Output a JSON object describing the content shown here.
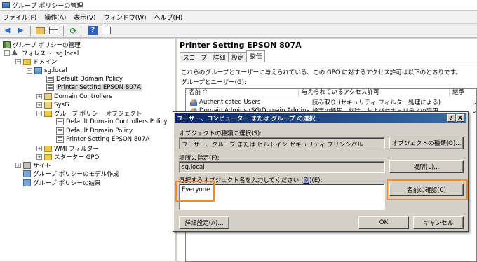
{
  "window": {
    "title": "グループ ポリシーの管理"
  },
  "menu": [
    "ファイル(F)",
    "操作(A)",
    "表示(V)",
    "ウィンドウ(W)",
    "ヘルプ(H)"
  ],
  "toolbar": {
    "icons": [
      "back-arrow-icon",
      "forward-arrow-icon",
      "up-folder-icon",
      "show-hide-tree-icon",
      "refresh-icon",
      "help-icon",
      "properties-icon"
    ]
  },
  "tree": {
    "root": "グループ ポリシーの管理",
    "forest": "フォレスト: sg.local",
    "domains": "ドメイン",
    "domain": "sg.local",
    "default_domain_policy": "Default Domain Policy",
    "printer_setting": "Printer Setting EPSON 807A",
    "domain_controllers": "Domain Controllers",
    "sysg": "SysG",
    "gpo_objects": "グループ ポリシー オブジェクト",
    "gpo_ddcp": "Default Domain Controllers Policy",
    "gpo_ddp": "Default Domain Policy",
    "gpo_printer": "Printer Setting EPSON 807A",
    "wmi_filters": "WMI フィルター",
    "starter_gpo": "スターター GPO",
    "sites": "サイト",
    "modeling": "グループ ポリシーのモデル作成",
    "results": "グループ ポリシーの結果"
  },
  "right": {
    "title": "Printer Setting EPSON 807A",
    "tabs": [
      "スコープ",
      "詳細",
      "設定",
      "委任"
    ],
    "active_tab": "委任",
    "description": "これらのグループとユーザーに与えられている、この GPO に対するアクセス許可は以下のとおりです。",
    "groups_label": "グループとユーザー(G):",
    "columns": [
      "名前 ^",
      "与えられているアクセス許可",
      "継承"
    ],
    "rows": [
      {
        "name": "Authenticated Users",
        "permission": "読み取り (セキュリティ フィルター処理による)",
        "inherit": "いい"
      },
      {
        "name": "Domain Admins (SG\\Domain Admins)",
        "permission": "設定の編集、削除、およびセキュリティの変更",
        "inherit": "いい"
      }
    ]
  },
  "dialog": {
    "title": "ユーザー、コンピューター または グループ の選択",
    "help_btn": "?",
    "close_btn": "X",
    "object_type_label": "オブジェクトの種類の選択(S):",
    "object_type_value": "ユーザー、グループ または ビルトイン セキュリティ プリンシパル",
    "object_type_button": "オブジェクトの種類(O)...",
    "location_label": "場所の指定(F):",
    "location_value": "sg.local",
    "location_button": "場所(L)...",
    "enter_label_prefix": "選択するオブジェクト名を入力してください (",
    "enter_label_link": "例",
    "enter_label_suffix": ")(E):",
    "object_name_value": "Everyone",
    "check_names_button": "名前の確認(C)",
    "advanced_button": "詳細設定(A)...",
    "ok_button": "OK",
    "cancel_button": "キャンセル"
  },
  "colors": {
    "highlight": "#f08a24",
    "dialog_title_start": "#0a246a",
    "dialog_title_end": "#3a6ea5",
    "link": "#0000cc"
  }
}
